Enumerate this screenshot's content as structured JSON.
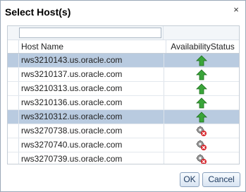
{
  "dialog": {
    "title": "Select Host(s)",
    "close_label": "×"
  },
  "table": {
    "columns": [
      "Host Name",
      "AvailabilityStatus"
    ],
    "filter_value": "",
    "rows": [
      {
        "host": "rws3210143.us.oracle.com",
        "status": "up",
        "status_icon": "up-arrow-icon",
        "selected": true
      },
      {
        "host": "rws3210137.us.oracle.com",
        "status": "up",
        "status_icon": "up-arrow-icon",
        "selected": false
      },
      {
        "host": "rws3210313.us.oracle.com",
        "status": "up",
        "status_icon": "up-arrow-icon",
        "selected": false
      },
      {
        "host": "rws3210136.us.oracle.com",
        "status": "up",
        "status_icon": "up-arrow-icon",
        "selected": false
      },
      {
        "host": "rws3210312.us.oracle.com",
        "status": "up",
        "status_icon": "up-arrow-icon",
        "selected": true
      },
      {
        "host": "rws3270738.us.oracle.com",
        "status": "error",
        "status_icon": "gear-error-icon",
        "selected": false
      },
      {
        "host": "rws3270740.us.oracle.com",
        "status": "error",
        "status_icon": "gear-error-icon",
        "selected": false
      },
      {
        "host": "rws3270739.us.oracle.com",
        "status": "error",
        "status_icon": "gear-error-icon",
        "selected": false
      }
    ]
  },
  "buttons": {
    "ok_label": "OK",
    "cancel_label": "Cancel"
  },
  "colors": {
    "selected_row": "#b9cbe0",
    "up_green": "#3aa53a",
    "error_red": "#d8262c"
  }
}
